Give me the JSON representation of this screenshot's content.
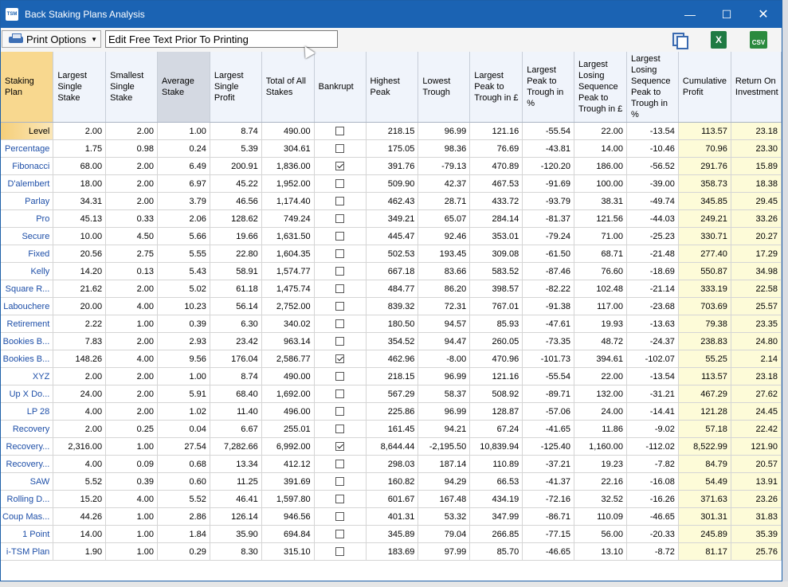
{
  "window": {
    "app_logo": "TSM",
    "title": "Back Staking Plans Analysis",
    "minimize": "—",
    "maximize": "☐",
    "close": "✕"
  },
  "toolbar": {
    "print_options_label": "Print Options",
    "free_text_value": "Edit Free Text Prior To Printing",
    "excel_label": "X",
    "csv_label": "CSV"
  },
  "columns": [
    "Staking Plan",
    "Largest Single Stake",
    "Smallest Single Stake",
    "Average Stake",
    "Largest Single Profit",
    "Total of All Stakes",
    "Bankrupt",
    "Highest Peak",
    "Lowest Trough",
    "Largest Peak to Trough in £",
    "Largest Peak to Trough in %",
    "Largest Losing Sequence Peak to Trough in £",
    "Largest Losing Sequence Peak to Trough in %",
    "Cumulative Profit",
    "Return On Investment"
  ],
  "selected_row": 0,
  "sorted_column": 3,
  "rows": [
    {
      "plan": "Level",
      "largest": "2.00",
      "smallest": "2.00",
      "average": "1.00",
      "profit": "8.74",
      "total": "490.00",
      "bankrupt": false,
      "peak": "218.15",
      "trough": "96.99",
      "ptt_gbp": "121.16",
      "ptt_pct": "-55.54",
      "lls_gbp": "22.00",
      "lls_pct": "-13.54",
      "cumulative": "113.57",
      "roi": "23.18"
    },
    {
      "plan": "Percentage",
      "largest": "1.75",
      "smallest": "0.98",
      "average": "0.24",
      "profit": "5.39",
      "total": "304.61",
      "bankrupt": false,
      "peak": "175.05",
      "trough": "98.36",
      "ptt_gbp": "76.69",
      "ptt_pct": "-43.81",
      "lls_gbp": "14.00",
      "lls_pct": "-10.46",
      "cumulative": "70.96",
      "roi": "23.30"
    },
    {
      "plan": "Fibonacci",
      "largest": "68.00",
      "smallest": "2.00",
      "average": "6.49",
      "profit": "200.91",
      "total": "1,836.00",
      "bankrupt": true,
      "peak": "391.76",
      "trough": "-79.13",
      "ptt_gbp": "470.89",
      "ptt_pct": "-120.20",
      "lls_gbp": "186.00",
      "lls_pct": "-56.52",
      "cumulative": "291.76",
      "roi": "15.89"
    },
    {
      "plan": "D'alembert",
      "largest": "18.00",
      "smallest": "2.00",
      "average": "6.97",
      "profit": "45.22",
      "total": "1,952.00",
      "bankrupt": false,
      "peak": "509.90",
      "trough": "42.37",
      "ptt_gbp": "467.53",
      "ptt_pct": "-91.69",
      "lls_gbp": "100.00",
      "lls_pct": "-39.00",
      "cumulative": "358.73",
      "roi": "18.38"
    },
    {
      "plan": "Parlay",
      "largest": "34.31",
      "smallest": "2.00",
      "average": "3.79",
      "profit": "46.56",
      "total": "1,174.40",
      "bankrupt": false,
      "peak": "462.43",
      "trough": "28.71",
      "ptt_gbp": "433.72",
      "ptt_pct": "-93.79",
      "lls_gbp": "38.31",
      "lls_pct": "-49.74",
      "cumulative": "345.85",
      "roi": "29.45"
    },
    {
      "plan": "Pro",
      "largest": "45.13",
      "smallest": "0.33",
      "average": "2.06",
      "profit": "128.62",
      "total": "749.24",
      "bankrupt": false,
      "peak": "349.21",
      "trough": "65.07",
      "ptt_gbp": "284.14",
      "ptt_pct": "-81.37",
      "lls_gbp": "121.56",
      "lls_pct": "-44.03",
      "cumulative": "249.21",
      "roi": "33.26"
    },
    {
      "plan": "Secure",
      "largest": "10.00",
      "smallest": "4.50",
      "average": "5.66",
      "profit": "19.66",
      "total": "1,631.50",
      "bankrupt": false,
      "peak": "445.47",
      "trough": "92.46",
      "ptt_gbp": "353.01",
      "ptt_pct": "-79.24",
      "lls_gbp": "71.00",
      "lls_pct": "-25.23",
      "cumulative": "330.71",
      "roi": "20.27"
    },
    {
      "plan": "Fixed",
      "largest": "20.56",
      "smallest": "2.75",
      "average": "5.55",
      "profit": "22.80",
      "total": "1,604.35",
      "bankrupt": false,
      "peak": "502.53",
      "trough": "193.45",
      "ptt_gbp": "309.08",
      "ptt_pct": "-61.50",
      "lls_gbp": "68.71",
      "lls_pct": "-21.48",
      "cumulative": "277.40",
      "roi": "17.29"
    },
    {
      "plan": "Kelly",
      "largest": "14.20",
      "smallest": "0.13",
      "average": "5.43",
      "profit": "58.91",
      "total": "1,574.77",
      "bankrupt": false,
      "peak": "667.18",
      "trough": "83.66",
      "ptt_gbp": "583.52",
      "ptt_pct": "-87.46",
      "lls_gbp": "76.60",
      "lls_pct": "-18.69",
      "cumulative": "550.87",
      "roi": "34.98"
    },
    {
      "plan": "Square R...",
      "largest": "21.62",
      "smallest": "2.00",
      "average": "5.02",
      "profit": "61.18",
      "total": "1,475.74",
      "bankrupt": false,
      "peak": "484.77",
      "trough": "86.20",
      "ptt_gbp": "398.57",
      "ptt_pct": "-82.22",
      "lls_gbp": "102.48",
      "lls_pct": "-21.14",
      "cumulative": "333.19",
      "roi": "22.58"
    },
    {
      "plan": "Labouchere",
      "largest": "20.00",
      "smallest": "4.00",
      "average": "10.23",
      "profit": "56.14",
      "total": "2,752.00",
      "bankrupt": false,
      "peak": "839.32",
      "trough": "72.31",
      "ptt_gbp": "767.01",
      "ptt_pct": "-91.38",
      "lls_gbp": "117.00",
      "lls_pct": "-23.68",
      "cumulative": "703.69",
      "roi": "25.57"
    },
    {
      "plan": "Retirement",
      "largest": "2.22",
      "smallest": "1.00",
      "average": "0.39",
      "profit": "6.30",
      "total": "340.02",
      "bankrupt": false,
      "peak": "180.50",
      "trough": "94.57",
      "ptt_gbp": "85.93",
      "ptt_pct": "-47.61",
      "lls_gbp": "19.93",
      "lls_pct": "-13.63",
      "cumulative": "79.38",
      "roi": "23.35"
    },
    {
      "plan": "Bookies B...",
      "largest": "7.83",
      "smallest": "2.00",
      "average": "2.93",
      "profit": "23.42",
      "total": "963.14",
      "bankrupt": false,
      "peak": "354.52",
      "trough": "94.47",
      "ptt_gbp": "260.05",
      "ptt_pct": "-73.35",
      "lls_gbp": "48.72",
      "lls_pct": "-24.37",
      "cumulative": "238.83",
      "roi": "24.80"
    },
    {
      "plan": "Bookies B...",
      "largest": "148.26",
      "smallest": "4.00",
      "average": "9.56",
      "profit": "176.04",
      "total": "2,586.77",
      "bankrupt": true,
      "peak": "462.96",
      "trough": "-8.00",
      "ptt_gbp": "470.96",
      "ptt_pct": "-101.73",
      "lls_gbp": "394.61",
      "lls_pct": "-102.07",
      "cumulative": "55.25",
      "roi": "2.14"
    },
    {
      "plan": "XYZ",
      "largest": "2.00",
      "smallest": "2.00",
      "average": "1.00",
      "profit": "8.74",
      "total": "490.00",
      "bankrupt": false,
      "peak": "218.15",
      "trough": "96.99",
      "ptt_gbp": "121.16",
      "ptt_pct": "-55.54",
      "lls_gbp": "22.00",
      "lls_pct": "-13.54",
      "cumulative": "113.57",
      "roi": "23.18"
    },
    {
      "plan": "Up X Do...",
      "largest": "24.00",
      "smallest": "2.00",
      "average": "5.91",
      "profit": "68.40",
      "total": "1,692.00",
      "bankrupt": false,
      "peak": "567.29",
      "trough": "58.37",
      "ptt_gbp": "508.92",
      "ptt_pct": "-89.71",
      "lls_gbp": "132.00",
      "lls_pct": "-31.21",
      "cumulative": "467.29",
      "roi": "27.62"
    },
    {
      "plan": "LP 28",
      "largest": "4.00",
      "smallest": "2.00",
      "average": "1.02",
      "profit": "11.40",
      "total": "496.00",
      "bankrupt": false,
      "peak": "225.86",
      "trough": "96.99",
      "ptt_gbp": "128.87",
      "ptt_pct": "-57.06",
      "lls_gbp": "24.00",
      "lls_pct": "-14.41",
      "cumulative": "121.28",
      "roi": "24.45"
    },
    {
      "plan": "Recovery",
      "largest": "2.00",
      "smallest": "0.25",
      "average": "0.04",
      "profit": "6.67",
      "total": "255.01",
      "bankrupt": false,
      "peak": "161.45",
      "trough": "94.21",
      "ptt_gbp": "67.24",
      "ptt_pct": "-41.65",
      "lls_gbp": "11.86",
      "lls_pct": "-9.02",
      "cumulative": "57.18",
      "roi": "22.42"
    },
    {
      "plan": "Recovery...",
      "largest": "2,316.00",
      "smallest": "1.00",
      "average": "27.54",
      "profit": "7,282.66",
      "total": "6,992.00",
      "bankrupt": true,
      "peak": "8,644.44",
      "trough": "-2,195.50",
      "ptt_gbp": "10,839.94",
      "ptt_pct": "-125.40",
      "lls_gbp": "1,160.00",
      "lls_pct": "-112.02",
      "cumulative": "8,522.99",
      "roi": "121.90"
    },
    {
      "plan": "Recovery...",
      "largest": "4.00",
      "smallest": "0.09",
      "average": "0.68",
      "profit": "13.34",
      "total": "412.12",
      "bankrupt": false,
      "peak": "298.03",
      "trough": "187.14",
      "ptt_gbp": "110.89",
      "ptt_pct": "-37.21",
      "lls_gbp": "19.23",
      "lls_pct": "-7.82",
      "cumulative": "84.79",
      "roi": "20.57"
    },
    {
      "plan": "SAW",
      "largest": "5.52",
      "smallest": "0.39",
      "average": "0.60",
      "profit": "11.25",
      "total": "391.69",
      "bankrupt": false,
      "peak": "160.82",
      "trough": "94.29",
      "ptt_gbp": "66.53",
      "ptt_pct": "-41.37",
      "lls_gbp": "22.16",
      "lls_pct": "-16.08",
      "cumulative": "54.49",
      "roi": "13.91"
    },
    {
      "plan": "Rolling D...",
      "largest": "15.20",
      "smallest": "4.00",
      "average": "5.52",
      "profit": "46.41",
      "total": "1,597.80",
      "bankrupt": false,
      "peak": "601.67",
      "trough": "167.48",
      "ptt_gbp": "434.19",
      "ptt_pct": "-72.16",
      "lls_gbp": "32.52",
      "lls_pct": "-16.26",
      "cumulative": "371.63",
      "roi": "23.26"
    },
    {
      "plan": "Coup Mas...",
      "largest": "44.26",
      "smallest": "1.00",
      "average": "2.86",
      "profit": "126.14",
      "total": "946.56",
      "bankrupt": false,
      "peak": "401.31",
      "trough": "53.32",
      "ptt_gbp": "347.99",
      "ptt_pct": "-86.71",
      "lls_gbp": "110.09",
      "lls_pct": "-46.65",
      "cumulative": "301.31",
      "roi": "31.83"
    },
    {
      "plan": "1 Point",
      "largest": "14.00",
      "smallest": "1.00",
      "average": "1.84",
      "profit": "35.90",
      "total": "694.84",
      "bankrupt": false,
      "peak": "345.89",
      "trough": "79.04",
      "ptt_gbp": "266.85",
      "ptt_pct": "-77.15",
      "lls_gbp": "56.00",
      "lls_pct": "-20.33",
      "cumulative": "245.89",
      "roi": "35.39"
    },
    {
      "plan": "i-TSM Plan",
      "largest": "1.90",
      "smallest": "1.00",
      "average": "0.29",
      "profit": "8.30",
      "total": "315.10",
      "bankrupt": false,
      "peak": "183.69",
      "trough": "97.99",
      "ptt_gbp": "85.70",
      "ptt_pct": "-46.65",
      "lls_gbp": "13.10",
      "lls_pct": "-8.72",
      "cumulative": "81.17",
      "roi": "25.76"
    }
  ]
}
